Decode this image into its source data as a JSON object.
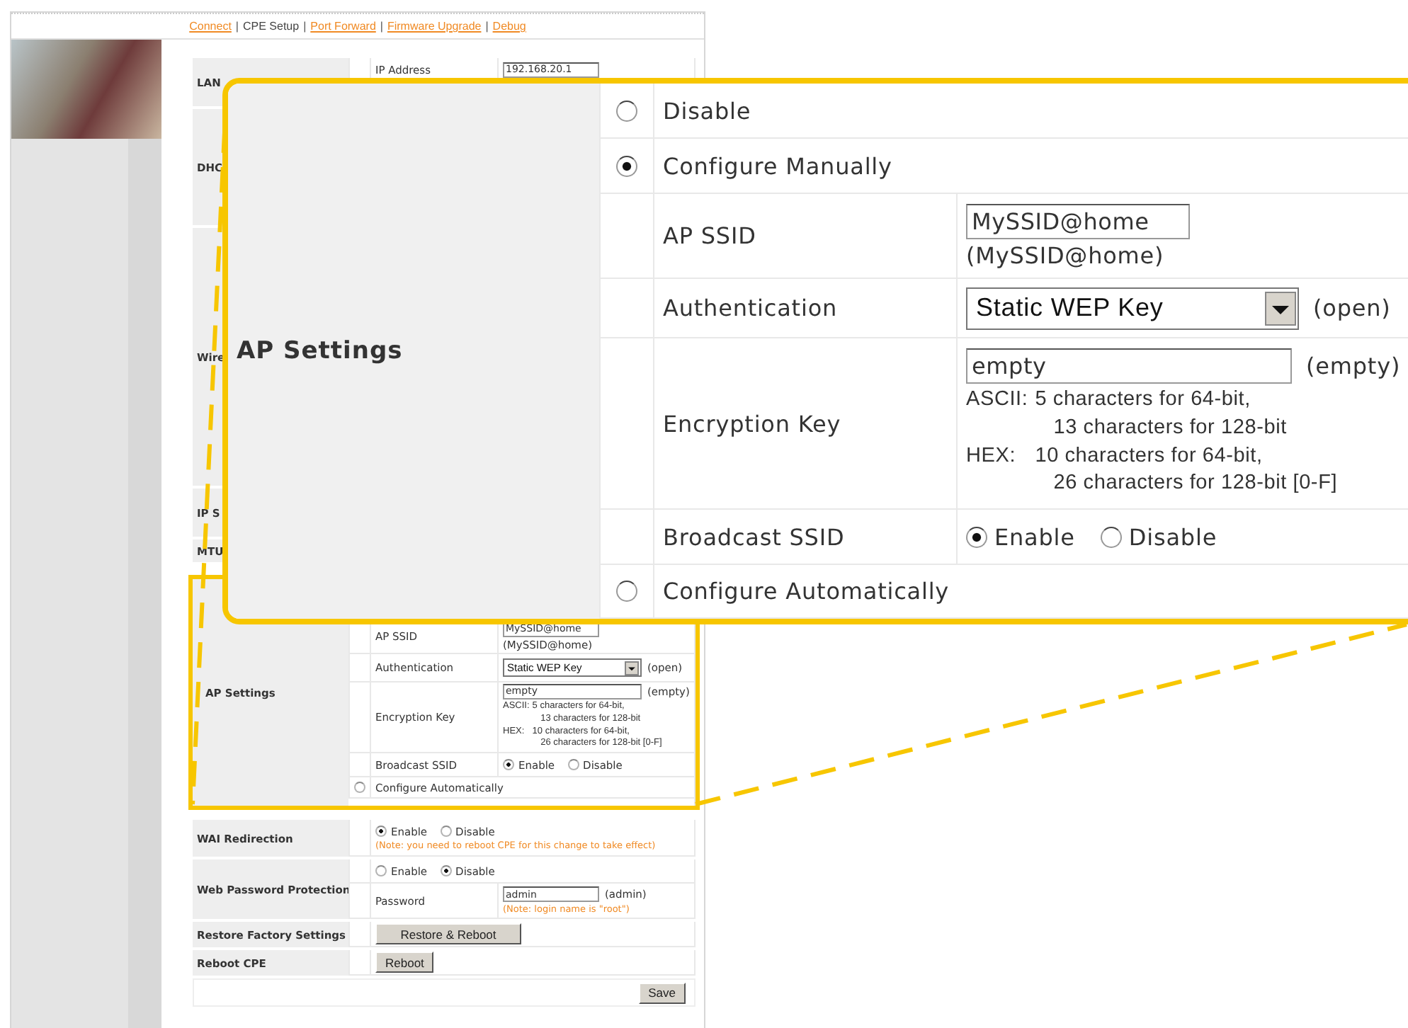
{
  "nav": [
    {
      "label": "Connect",
      "selected": false
    },
    {
      "label": "CPE Setup",
      "selected": true,
      "separator": "|"
    },
    {
      "label": "Port Forward",
      "selected": false,
      "separator": "|"
    },
    {
      "label": "Firmware Upgrade",
      "selected": false,
      "separator": "|"
    },
    {
      "label": "Debug",
      "selected": false,
      "separator": "|"
    }
  ],
  "sections_above": [
    {
      "label": "LAN",
      "fields": [
        {
          "label": "IP Address",
          "value": "192.168.20.1"
        }
      ]
    },
    {
      "label": "DHC"
    },
    {
      "label": "Wire"
    },
    {
      "label": "IP S"
    },
    {
      "label": "MTU"
    }
  ],
  "ap_settings_page": {
    "label": "AP Settings",
    "fields": [
      {
        "kind": "text",
        "label": "AP SSID",
        "value": "MySSID@home",
        "default": "(MySSID@home)"
      },
      {
        "kind": "select",
        "label": "Authentication",
        "value": "Static WEP Key",
        "default": "(open)"
      },
      {
        "kind": "key",
        "label": "Encryption Key",
        "value": "empty",
        "default": "(empty)",
        "hints": [
          {
            "prefix": "ASCII:",
            "lines": [
              "5 characters for 64-bit,",
              "13 characters for 128-bit"
            ]
          },
          {
            "prefix": "HEX:",
            "lines": [
              "10 characters for 64-bit,",
              "26 characters for 128-bit [0-F]"
            ]
          }
        ]
      },
      {
        "kind": "radio",
        "label": "Broadcast SSID",
        "choices": [
          {
            "label": "Enable",
            "selected": true
          },
          {
            "label": "Disable",
            "selected": false
          }
        ]
      }
    ],
    "auto_option": {
      "label": "Configure Automatically",
      "selected": false
    }
  },
  "wai": {
    "label": "WAI Redirection",
    "choices": [
      {
        "label": "Enable",
        "selected": true
      },
      {
        "label": "Disable",
        "selected": false
      }
    ],
    "note": "(Note: you need to reboot CPE for this change to take effect)"
  },
  "web_password": {
    "label": "Web Password Protection",
    "choices": [
      {
        "label": "Enable",
        "selected": false
      },
      {
        "label": "Disable",
        "selected": true
      }
    ],
    "password": {
      "label": "Password",
      "value": "admin",
      "default": "(admin)",
      "note": "(Note: login name is \"root\")"
    }
  },
  "restore": {
    "label": "Restore Factory Settings",
    "button": "Restore & Reboot"
  },
  "reboot": {
    "label": "Reboot CPE",
    "button": "Reboot"
  },
  "save_button": "Save",
  "callout": {
    "label": "AP Settings",
    "options": [
      {
        "label": "Disable",
        "selected": false
      },
      {
        "label": "Configure Manually",
        "selected": true
      }
    ],
    "fields": [
      {
        "kind": "text",
        "label": "AP SSID",
        "value": "MySSID@home",
        "default": "(MySSID@home)"
      },
      {
        "kind": "select",
        "label": "Authentication",
        "value": "Static WEP Key",
        "default": "(open)"
      },
      {
        "kind": "key",
        "label": "Encryption Key",
        "value": "empty",
        "default": "(empty)",
        "hints": [
          {
            "prefix": "ASCII:",
            "lines": [
              "5 characters for 64-bit,",
              "13 characters for 128-bit"
            ]
          },
          {
            "prefix": "HEX:",
            "lines": [
              "10 characters for 64-bit,",
              "26 characters for 128-bit [0-F]"
            ]
          }
        ]
      },
      {
        "kind": "radio",
        "label": "Broadcast SSID",
        "choices": [
          {
            "label": "Enable",
            "selected": true
          },
          {
            "label": "Disable",
            "selected": false
          }
        ]
      }
    ],
    "auto_option": {
      "label": "Configure Automatically",
      "selected": false
    }
  }
}
